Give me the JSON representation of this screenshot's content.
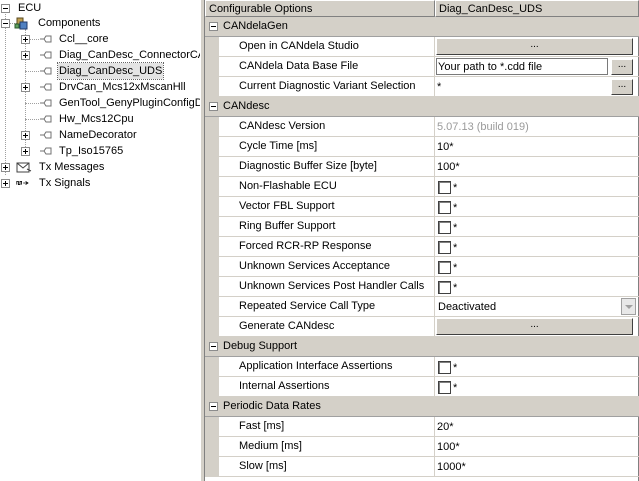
{
  "tree": {
    "root": "ECU",
    "components": "Components",
    "children": [
      "Ccl__core",
      "Diag_CanDesc_ConnectorCA",
      "Diag_CanDesc_UDS",
      "DrvCan_Mcs12xMscanHll",
      "GenTool_GenyPluginConfigD",
      "Hw_Mcs12Cpu",
      "NameDecorator",
      "Tp_Iso15765"
    ],
    "selected": "Diag_CanDesc_UDS",
    "tx_messages": "Tx Messages",
    "tx_signals": "Tx Signals"
  },
  "grid": {
    "header_options": "Configurable Options",
    "header_value": "Diag_CanDesc_UDS",
    "sections": {
      "candelagen": "CANdelaGen",
      "candesc": "CANdesc",
      "debug": "Debug Support",
      "rates": "Periodic Data Rates"
    },
    "rows": {
      "open_candela": "Open in CANdela Studio",
      "db_file": "CANdela Data Base File",
      "variant": "Current Diagnostic Variant Selection",
      "version": "CANdesc Version",
      "cycle": "Cycle Time [ms]",
      "buffer": "Diagnostic Buffer Size [byte]",
      "non_flash": "Non-Flashable ECU",
      "vector_fbl": "Vector FBL Support",
      "ring_buffer": "Ring Buffer Support",
      "rcr_rp": "Forced RCR-RP Response",
      "unknown_acc": "Unknown Services Acceptance",
      "unknown_post": "Unknown Services Post Handler Calls",
      "repeated": "Repeated Service Call Type",
      "generate": "Generate CANdesc",
      "app_assert": "Application Interface Assertions",
      "int_assert": "Internal Assertions",
      "fast": "Fast [ms]",
      "medium": "Medium [ms]",
      "slow": "Slow [ms]"
    },
    "values": {
      "dots": "...",
      "db_file": "Your path to *.cdd file",
      "variant": "*",
      "version": "5.07.13 (build 019)",
      "cycle": "10*",
      "buffer": "100*",
      "star": "*",
      "repeated": "Deactivated",
      "fast": "20*",
      "medium": "100*",
      "slow": "1000*"
    }
  }
}
